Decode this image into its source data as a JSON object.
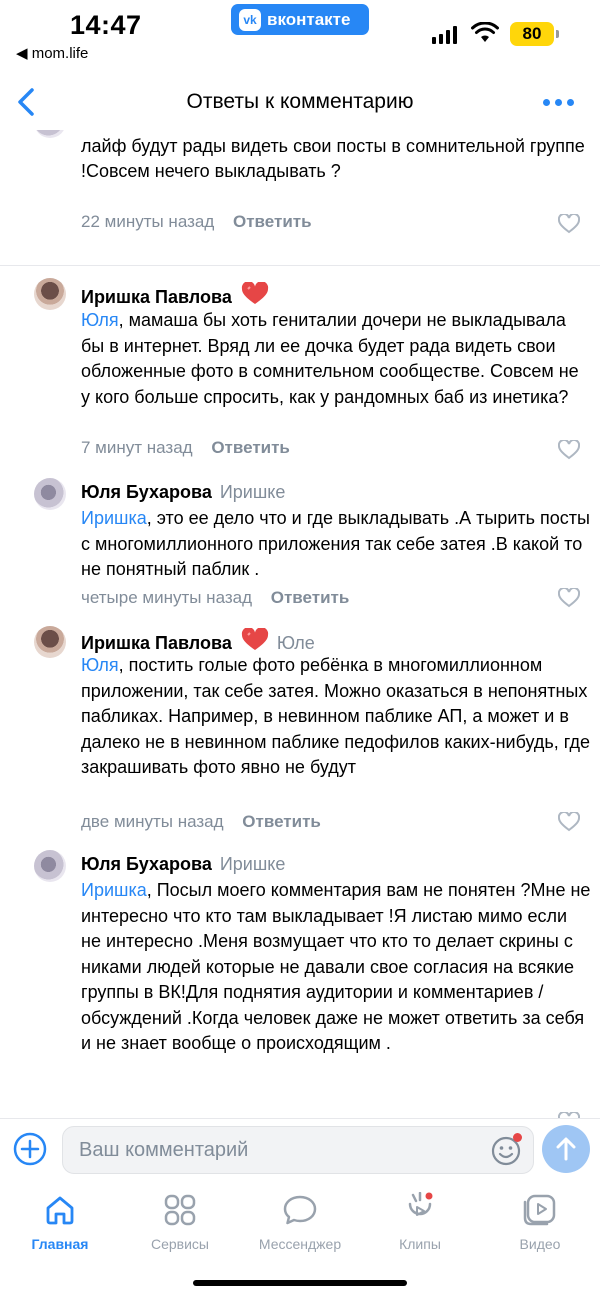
{
  "status_bar": {
    "time": "14:47",
    "back_app": "◀ mom.life",
    "app_badge": "вконтакте",
    "app_badge_logo": "vk",
    "battery": "80",
    "battery_color": "#ffd60a"
  },
  "nav": {
    "title": "Ответы к комментарию",
    "back_icon": "chevron-left-icon",
    "more_icon": "more-dots-icon"
  },
  "comments": [
    {
      "author": "",
      "reply_to": "",
      "mention": "",
      "text": "Вы бы хоть Ники замазали бы !Вряд ли пользователи мама лайф будут рады видеть свои посты в сомнительной группе !Совсем нечего выкладывать ?",
      "time": "22 минуты назад",
      "reply_label": "Ответить"
    },
    {
      "author": "Иришка Павлова",
      "reply_to": "",
      "mention": "Юля",
      "text": ", мамаша бы хоть гениталии дочери не выкладывала бы в интернет. Вряд ли ее дочка будет рада видеть свои обложенные фото в сомнительном сообществе. Совсем не у кого больше спросить, как у рандомных баб из инетика?",
      "time": "7 минут назад",
      "reply_label": "Ответить"
    },
    {
      "author": "Юля Бухарова",
      "reply_to": "Иришке",
      "mention": "Иришка",
      "text": ", это ее дело что и где выкладывать .А тырить посты с многомиллионного приложения так себе затея .В какой то не понятный паблик .",
      "time": "четыре минуты назад",
      "reply_label": "Ответить"
    },
    {
      "author": "Иришка Павлова",
      "reply_to": "Юле",
      "mention": "Юля",
      "text": ", постить голые фото ребёнка в многомиллионном приложении, так себе затея. Можно оказаться в непонятных пабликах. Например, в невинном паблике АП, а может и в далеко не в невинном паблике педофилов каких-нибудь, где закрашивать фото явно не будут",
      "time": "две минуты назад",
      "reply_label": "Ответить"
    },
    {
      "author": "Юля Бухарова",
      "reply_to": "Иришке",
      "mention": "Иришка",
      "text": ", Посыл моего комментария вам не понятен ?Мне не интересно что кто там выкладывает !Я листаю мимо если не интересно .Меня возмущает что кто то делает скрины с никами людей которые не давали свое согласия на всякие группы в ВК!Для поднятия аудитории и комментариев / обсуждений .Когда человек даже не может ответить за себя и не знает вообще о происходящим .",
      "time": "",
      "reply_label": ""
    }
  ],
  "composer": {
    "placeholder": "Ваш комментарий"
  },
  "tabs": [
    {
      "label": "Главная",
      "icon": "home-icon",
      "active": true
    },
    {
      "label": "Сервисы",
      "icon": "services-icon",
      "active": false
    },
    {
      "label": "Мессенджер",
      "icon": "messenger-icon",
      "active": false
    },
    {
      "label": "Клипы",
      "icon": "clips-icon",
      "active": false
    },
    {
      "label": "Видео",
      "icon": "video-icon",
      "active": false
    }
  ],
  "colors": {
    "accent": "#2787f5",
    "secondary_text": "#818c99",
    "heart": "#e64646"
  }
}
